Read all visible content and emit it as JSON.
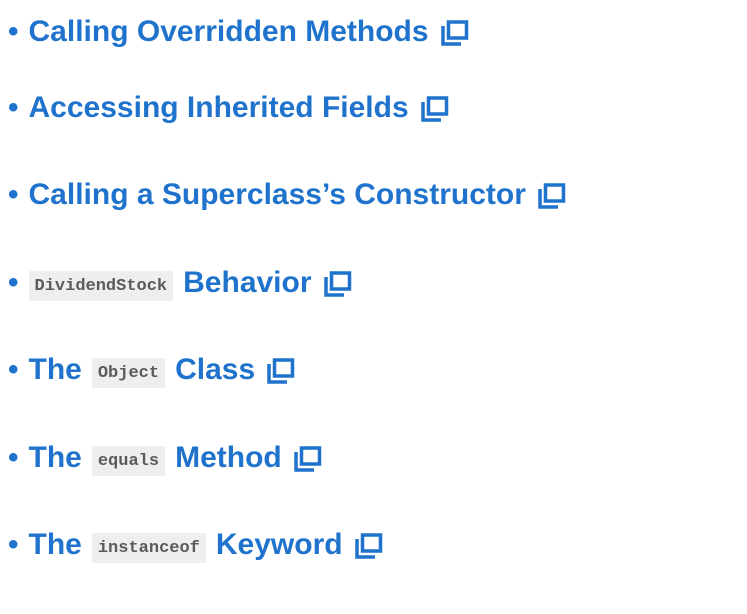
{
  "toc": {
    "items": [
      {
        "before": "Calling Overridden Methods",
        "code": "",
        "after": ""
      },
      {
        "before": "Accessing Inherited Fields",
        "code": "",
        "after": ""
      },
      {
        "before": "Calling a Superclass’s Constructor",
        "code": "",
        "after": ""
      },
      {
        "before": "",
        "code": "DividendStock",
        "after": "Behavior"
      },
      {
        "before": "The",
        "code": "Object",
        "after": "Class"
      },
      {
        "before": "The",
        "code": "equals",
        "after": "Method"
      },
      {
        "before": "The",
        "code": "instanceof",
        "after": "Keyword"
      }
    ],
    "bullet": "•",
    "link_color": "#1f73cc",
    "icon": "open-in-new-window-icon"
  }
}
